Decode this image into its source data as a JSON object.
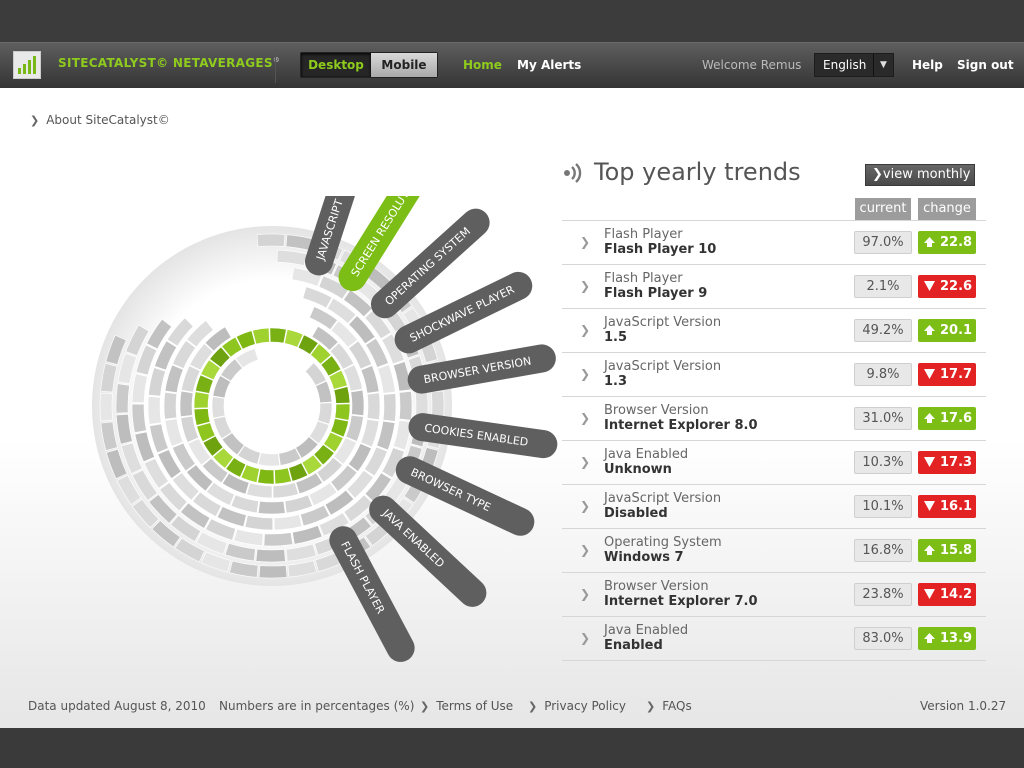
{
  "header": {
    "brand": "SITECATALYST© NETAVERAGES",
    "brand_tm": "®",
    "view_toggle": {
      "desktop": "Desktop",
      "mobile": "Mobile",
      "active": "Desktop"
    },
    "nav": {
      "home": "Home",
      "alerts": "My Alerts"
    },
    "welcome": "Welcome Remus",
    "language": "English",
    "help": "Help",
    "signout": "Sign out"
  },
  "breadcrumb": {
    "about": "About SiteCatalyst©"
  },
  "wheel": {
    "labels": [
      "JAVASCRIPT VERSION",
      "SCREEN RESOLUTION",
      "OPERATING SYSTEM",
      "SHOCKWAVE PLAYER",
      "BROWSER VERSION",
      "COOKIES ENABLED",
      "BROWSER TYPE",
      "JAVA ENABLED",
      "FLASH PLAYER"
    ],
    "selected": "SCREEN RESOLUTION"
  },
  "trends": {
    "title": "Top yearly trends",
    "toggle": "view monthly",
    "columns": {
      "current": "current",
      "change": "change"
    },
    "rows": [
      {
        "category": "Flash Player",
        "value": "Flash Player 10",
        "current": "97.0%",
        "change": "22.8",
        "direction": "up"
      },
      {
        "category": "Flash Player",
        "value": "Flash Player 9",
        "current": "2.1%",
        "change": "22.6",
        "direction": "down"
      },
      {
        "category": "JavaScript Version",
        "value": "1.5",
        "current": "49.2%",
        "change": "20.1",
        "direction": "up"
      },
      {
        "category": "JavaScript Version",
        "value": "1.3",
        "current": "9.8%",
        "change": "17.7",
        "direction": "down"
      },
      {
        "category": "Browser Version",
        "value": "Internet Explorer 8.0",
        "current": "31.0%",
        "change": "17.6",
        "direction": "up"
      },
      {
        "category": "Java Enabled",
        "value": "Unknown",
        "current": "10.3%",
        "change": "17.3",
        "direction": "down"
      },
      {
        "category": "JavaScript Version",
        "value": "Disabled",
        "current": "10.1%",
        "change": "16.1",
        "direction": "down"
      },
      {
        "category": "Operating System",
        "value": "Windows 7",
        "current": "16.8%",
        "change": "15.8",
        "direction": "up"
      },
      {
        "category": "Browser Version",
        "value": "Internet Explorer 7.0",
        "current": "23.8%",
        "change": "14.2",
        "direction": "down"
      },
      {
        "category": "Java Enabled",
        "value": "Enabled",
        "current": "83.0%",
        "change": "13.9",
        "direction": "up"
      }
    ]
  },
  "footer": {
    "updated": "Data updated August 8, 2010",
    "units": "Numbers are in percentages (%)",
    "terms": "Terms of Use",
    "privacy": "Privacy Policy",
    "faqs": "FAQs",
    "version": "Version 1.0.27"
  },
  "colors": {
    "accent_green": "#8ecb1c",
    "up": "#7cbe15",
    "down": "#e32323",
    "tab_dark": "#5f5f5f"
  }
}
